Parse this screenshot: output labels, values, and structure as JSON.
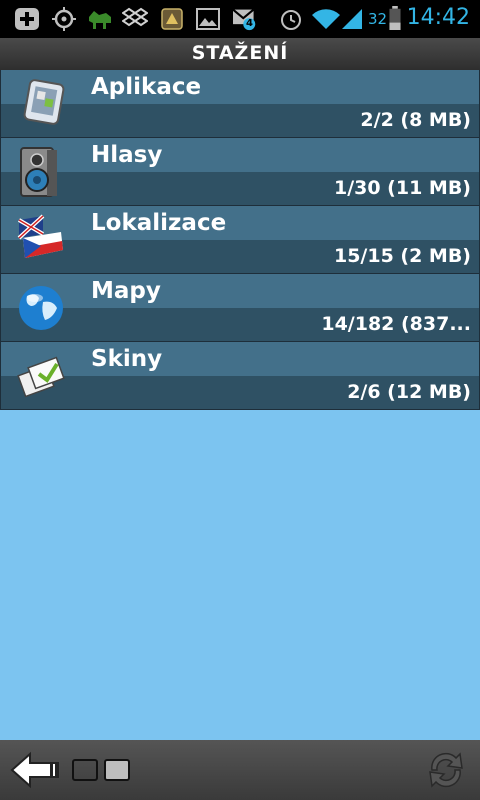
{
  "status_bar": {
    "time": "14:42",
    "battery_percent": "32",
    "notification_badge": "4",
    "icons": [
      "add-icon",
      "gps-icon",
      "android-icon",
      "dropbox-icon",
      "app-icon",
      "image-icon",
      "gmail-icon",
      "alarm-icon",
      "wifi-icon",
      "signal-icon",
      "battery-icon"
    ]
  },
  "header": {
    "title": "STAŽENÍ"
  },
  "downloads": [
    {
      "title": "Aplikace",
      "count": "2/2 (8 MB)",
      "icon": "apps-icon"
    },
    {
      "title": "Hlasy",
      "count": "1/30 (11 MB)",
      "icon": "speaker-icon"
    },
    {
      "title": "Lokalizace",
      "count": "15/15 (2 MB)",
      "icon": "flags-icon"
    },
    {
      "title": "Mapy",
      "count": "14/182 (837...",
      "icon": "globe-icon"
    },
    {
      "title": "Skiny",
      "count": "2/6 (12 MB)",
      "icon": "skins-icon"
    }
  ],
  "bottom_bar": {
    "icons": [
      "back-arrow-icon",
      "window-switch-icon",
      "refresh-icon"
    ]
  },
  "colors": {
    "background": "#7cc4f0",
    "row_top": "#43708a",
    "row_bottom": "#2f5164",
    "accent": "#33b5e5"
  }
}
